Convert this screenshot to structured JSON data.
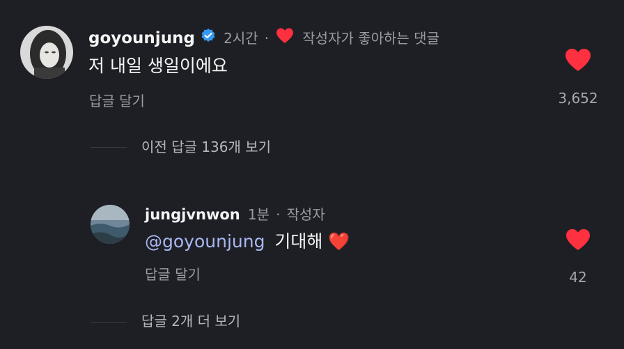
{
  "comment": {
    "username": "goyounjung",
    "verified_icon": "verified-badge-icon",
    "time": "2시간",
    "separator": "·",
    "creator_liked_label": "작성자가 좋아하는 댓글",
    "text": "저 내일 생일이에요",
    "reply_label": "답글 달기",
    "like_count": "3,652",
    "like_icon": "heart-filled-icon",
    "like_color": "#ff3040"
  },
  "view_previous_replies": "이전 답글 136개 보기",
  "reply": {
    "username": "jungjvnwon",
    "time": "1분",
    "separator": "·",
    "author_label": "작성자",
    "mention": "@goyounjung",
    "text": "기대해",
    "emoji": "❤️",
    "reply_label": "답글 달기",
    "like_count": "42",
    "like_icon": "heart-filled-icon"
  },
  "view_more_replies": "답글 2개 더 보기",
  "colors": {
    "background": "#1e1f24",
    "verified_blue": "#3897f0",
    "mention": "#a9b7f2",
    "heart_red": "#ff3040",
    "secondary_text": "#9a9ca3"
  }
}
